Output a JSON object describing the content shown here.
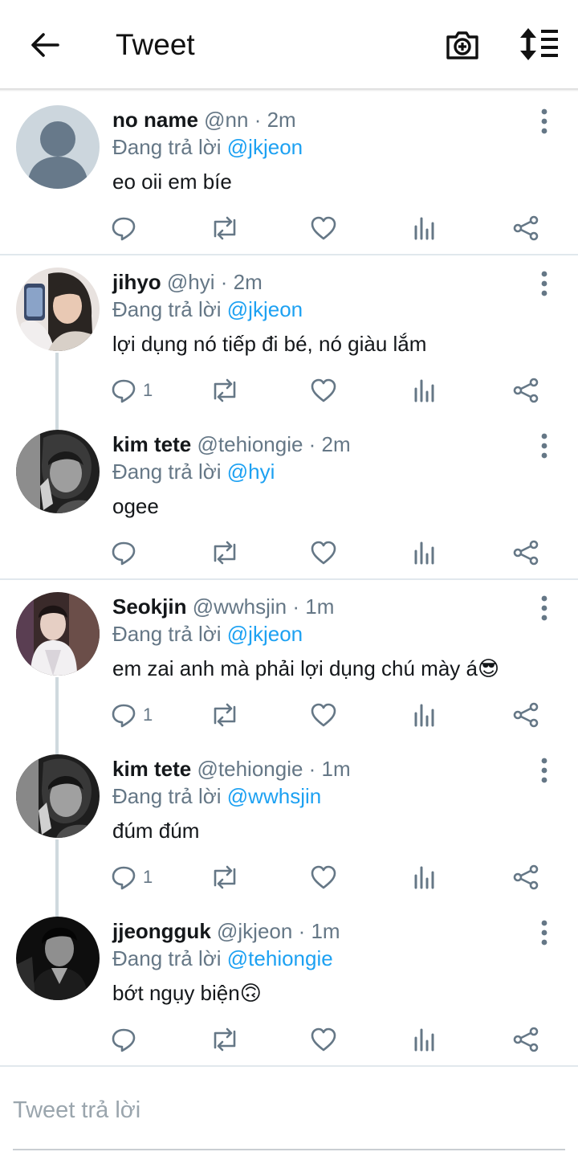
{
  "header": {
    "title": "Tweet",
    "back_icon": "arrow-left-icon",
    "camera_icon": "camera-add-icon",
    "sort_icon": "sort-icon"
  },
  "colors": {
    "accent": "#1da1f2",
    "secondary_text": "#657786",
    "divider": "#e1e8ed"
  },
  "tweets": [
    {
      "name": "no name",
      "handle": "@nn",
      "sep": " · ",
      "time": "2m",
      "reply_prefix": "Đang trả lời ",
      "reply_to": "@jkjeon",
      "text": "eo oii em bíe",
      "reply_count": ""
    },
    {
      "name": "jihyo",
      "handle": "@hyi",
      "sep": " · ",
      "time": "2m",
      "reply_prefix": "Đang trả lời ",
      "reply_to": "@jkjeon",
      "text": "lợi dụng nó tiếp đi bé, nó giàu lắm",
      "reply_count": "1"
    },
    {
      "name": "kim tete",
      "handle": "@tehiongie",
      "sep": " · ",
      "time": "2m",
      "reply_prefix": "Đang trả lời ",
      "reply_to": "@hyi",
      "text": "ogee",
      "reply_count": ""
    },
    {
      "name": "Seokjin",
      "handle": "@wwhsjin",
      "sep": " · ",
      "time": "1m",
      "reply_prefix": "Đang trả lời ",
      "reply_to": "@jkjeon",
      "text": "em zai anh mà phải lợi dụng chú mày á",
      "emoji": "😎",
      "reply_count": "1"
    },
    {
      "name": "kim tete",
      "handle": "@tehiongie",
      "sep": " · ",
      "time": "1m",
      "reply_prefix": "Đang trả lời ",
      "reply_to": "@wwhsjin",
      "text": "đúm đúm",
      "reply_count": "1"
    },
    {
      "name": "jjeongguk",
      "handle": "@jkjeon",
      "sep": " · ",
      "time": "1m",
      "reply_prefix": "Đang trả lời ",
      "reply_to": "@tehiongie",
      "text": "bớt ngụy biện",
      "emoji": "🙃",
      "reply_count": ""
    }
  ],
  "compose": {
    "placeholder": "Tweet trả lời"
  }
}
